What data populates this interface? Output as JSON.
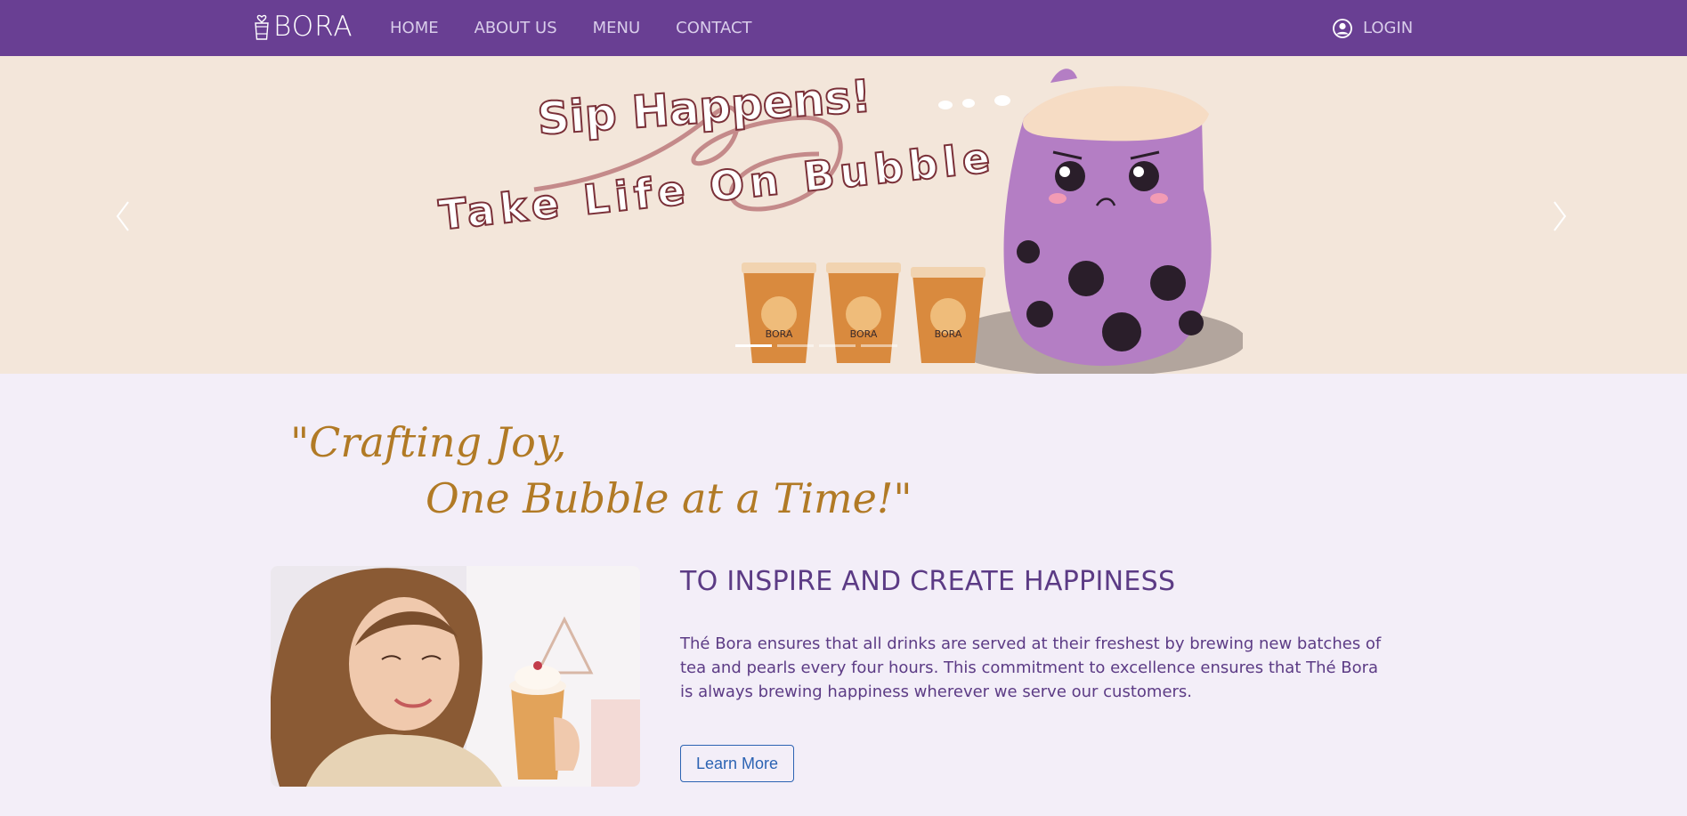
{
  "brand": {
    "logo_text": "BORA"
  },
  "nav": {
    "links": [
      {
        "label": "HOME"
      },
      {
        "label": "ABOUT US"
      },
      {
        "label": "MENU"
      },
      {
        "label": "CONTACT"
      }
    ],
    "login_label": "LOGIN"
  },
  "hero": {
    "headline_1": "Sip Happens!",
    "headline_2": "Take Life On Bubble",
    "cup_label": "BORA",
    "active_slide": 0,
    "slide_count": 4
  },
  "slogan": {
    "line_1": "\"Crafting Joy,",
    "line_2": "One Bubble at a Time!\""
  },
  "feature": {
    "title": "TO INSPIRE AND CREATE HAPPINESS",
    "body": "Thé Bora ensures that all drinks are served at their freshest by brewing new batches of tea and pearls every four hours. This commitment to excellence ensures that Thé Bora is always brewing happiness wherever we serve our customers.",
    "button_label": "Learn More"
  },
  "colors": {
    "nav_bg": "#693f93",
    "page_bg": "#f3eef8",
    "hero_bg": "#f3e6da",
    "slogan": "#b17a25",
    "heading": "#5c3b85",
    "button": "#2c63b3"
  }
}
